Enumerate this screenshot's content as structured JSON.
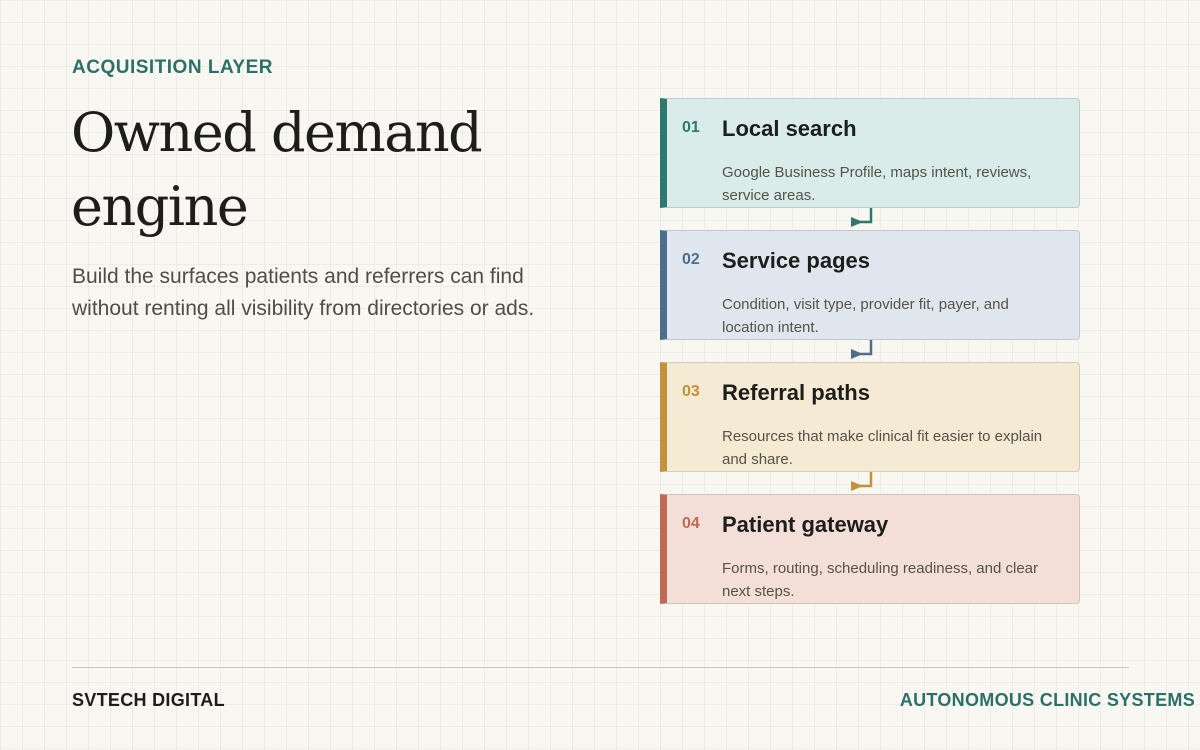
{
  "header": {
    "eyebrow": "ACQUISITION LAYER",
    "title_line1": "Owned demand",
    "title_line2": "engine",
    "subtitle_line1": "Build the surfaces patients and referrers can find",
    "subtitle_line2": "without renting all visibility from directories or ads."
  },
  "steps": [
    {
      "number": "01",
      "title": "Local search",
      "desc_line1": "Google Business Profile, maps intent, reviews,",
      "desc_line2": "service areas.",
      "accent": "#2f7870",
      "bg": "#d9ecea"
    },
    {
      "number": "02",
      "title": "Service pages",
      "desc_line1": "Condition, visit type, provider fit, payer, and",
      "desc_line2": "location intent.",
      "accent": "#4f6e8c",
      "bg": "#dfe6ee"
    },
    {
      "number": "03",
      "title": "Referral paths",
      "desc_line1": "Resources that make clinical fit easier to explain",
      "desc_line2": "and share.",
      "accent": "#c2913b",
      "bg": "#f5ead3"
    },
    {
      "number": "04",
      "title": "Patient gateway",
      "desc_line1": "Forms, routing, scheduling readiness, and clear",
      "desc_line2": "next steps.",
      "accent": "#c26856",
      "bg": "#f3dfd8"
    }
  ],
  "footer": {
    "left": "SVTECH DIGITAL",
    "right": "AUTONOMOUS CLINIC SYSTEMS"
  }
}
